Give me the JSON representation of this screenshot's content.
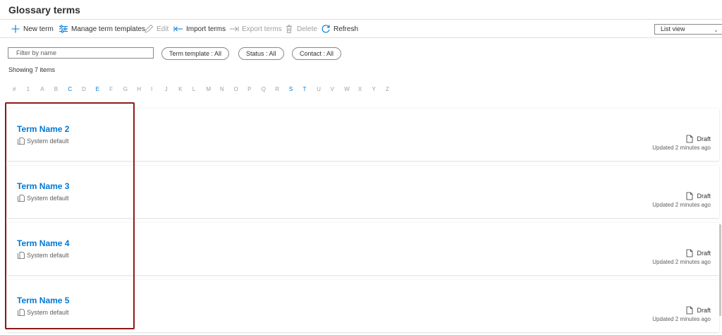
{
  "page": {
    "title": "Glossary terms"
  },
  "toolbar": {
    "new_term": "New term",
    "manage_templates": "Manage term templates",
    "edit": "Edit",
    "import_terms": "Import terms",
    "export_terms": "Export terms",
    "delete": "Delete",
    "refresh": "Refresh"
  },
  "view": {
    "selected": "List view"
  },
  "filters": {
    "name_placeholder": "Filter by name",
    "term_template": "Term template : All",
    "status": "Status : All",
    "contact": "Contact : All"
  },
  "showing": "Showing 7 items",
  "alphabet": [
    {
      "ch": "#",
      "active": false
    },
    {
      "ch": "1",
      "active": false
    },
    {
      "ch": "A",
      "active": false
    },
    {
      "ch": "B",
      "active": false
    },
    {
      "ch": "C",
      "active": true
    },
    {
      "ch": "D",
      "active": false
    },
    {
      "ch": "E",
      "active": true
    },
    {
      "ch": "F",
      "active": false
    },
    {
      "ch": "G",
      "active": false
    },
    {
      "ch": "H",
      "active": false
    },
    {
      "ch": "I",
      "active": false
    },
    {
      "ch": "J",
      "active": false
    },
    {
      "ch": "K",
      "active": false
    },
    {
      "ch": "L",
      "active": false
    },
    {
      "ch": "M",
      "active": false
    },
    {
      "ch": "N",
      "active": false
    },
    {
      "ch": "O",
      "active": false
    },
    {
      "ch": "P",
      "active": false
    },
    {
      "ch": "Q",
      "active": false
    },
    {
      "ch": "R",
      "active": false
    },
    {
      "ch": "S",
      "active": true
    },
    {
      "ch": "T",
      "active": true
    },
    {
      "ch": "U",
      "active": false
    },
    {
      "ch": "V",
      "active": false
    },
    {
      "ch": "W",
      "active": false
    },
    {
      "ch": "X",
      "active": false
    },
    {
      "ch": "Y",
      "active": false
    },
    {
      "ch": "Z",
      "active": false
    }
  ],
  "terms": [
    {
      "name": "Term Name 2",
      "template": "System default",
      "status": "Draft",
      "updated": "Updated 2 minutes ago"
    },
    {
      "name": "Term Name 3",
      "template": "System default",
      "status": "Draft",
      "updated": "Updated 2 minutes ago"
    },
    {
      "name": "Term Name 4",
      "template": "System default",
      "status": "Draft",
      "updated": "Updated 2 minutes ago"
    },
    {
      "name": "Term Name 5",
      "template": "System default",
      "status": "Draft",
      "updated": "Updated 2 minutes ago"
    }
  ],
  "colors": {
    "accent": "#0078d4",
    "highlight_border": "#8b1a1a",
    "disabled": "#a19f9d"
  },
  "icons": {
    "new_term": "plus-icon",
    "manage_templates": "sliders-icon",
    "edit": "pencil-icon",
    "import_terms": "import-arrow-icon",
    "export_terms": "export-arrow-icon",
    "delete": "trash-icon",
    "refresh": "refresh-icon",
    "template": "template-document-icon",
    "status": "document-icon"
  }
}
